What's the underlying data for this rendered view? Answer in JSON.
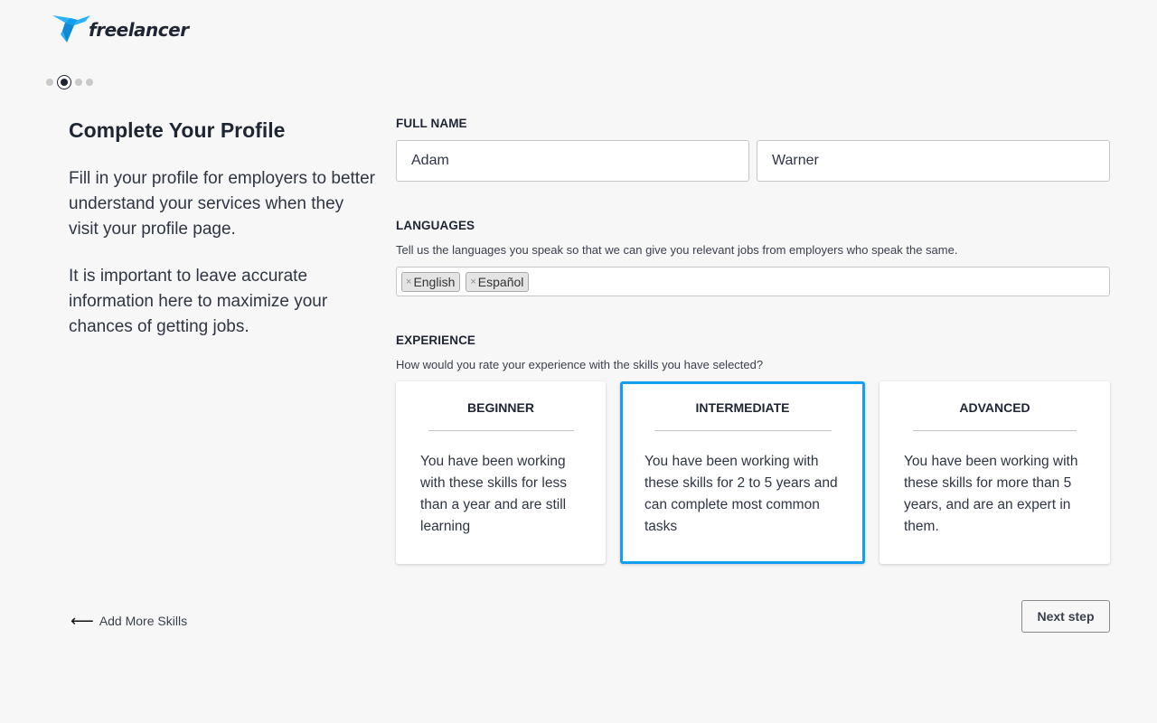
{
  "brand": {
    "logo_icon": "freelancer-bird-icon",
    "name": "freelancer",
    "accent_color": "#139ff0"
  },
  "progress": {
    "total_steps": 4,
    "current_step": 2
  },
  "intro": {
    "title": "Complete Your Profile",
    "paragraph_1": "Fill in your profile for employers to better understand your services when they visit your profile page.",
    "paragraph_2": "It is important to leave accurate information here to maximize your chances of getting jobs."
  },
  "full_name": {
    "label": "FULL NAME",
    "first_name": "Adam",
    "last_name": "Warner"
  },
  "languages": {
    "label": "LANGUAGES",
    "help": "Tell us the languages you speak so that we can give you relevant jobs from employers who speak the same.",
    "tags": [
      "English",
      "Español"
    ],
    "remove_icon": "×"
  },
  "experience": {
    "label": "EXPERIENCE",
    "help": "How would you rate your experience with the skills you have selected?",
    "selected": "Intermediate",
    "options": [
      {
        "title": "BEGINNER",
        "description": "You have been working with these skills for less than a year and are still learning"
      },
      {
        "title": "INTERMEDIATE",
        "description": "You have been working with these skills for 2 to 5 years and can complete most common tasks"
      },
      {
        "title": "ADVANCED",
        "description": "You have been working with these skills for more than 5 years, and are an expert in them."
      }
    ]
  },
  "footer": {
    "back_label": "Add More Skills",
    "back_icon": "⟵",
    "next_label": "Next step"
  }
}
